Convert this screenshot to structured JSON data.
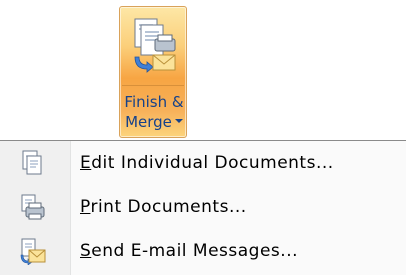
{
  "ribbon_button": {
    "label_line1": "Finish &",
    "label_line2": "Merge",
    "icon": "finish-merge-icon",
    "colors": {
      "gradient_top": "#fde7a6",
      "gradient_mid": "#f7a543",
      "border": "#d9a25a",
      "label": "#15428b"
    }
  },
  "menu": {
    "items": [
      {
        "mnemonic": "E",
        "rest": "dit Individual Documents...",
        "icon": "edit-documents-icon"
      },
      {
        "mnemonic": "P",
        "rest": "rint Documents...",
        "icon": "print-documents-icon"
      },
      {
        "mnemonic": "S",
        "rest": "end E-mail Messages...",
        "icon": "send-email-icon"
      }
    ]
  }
}
